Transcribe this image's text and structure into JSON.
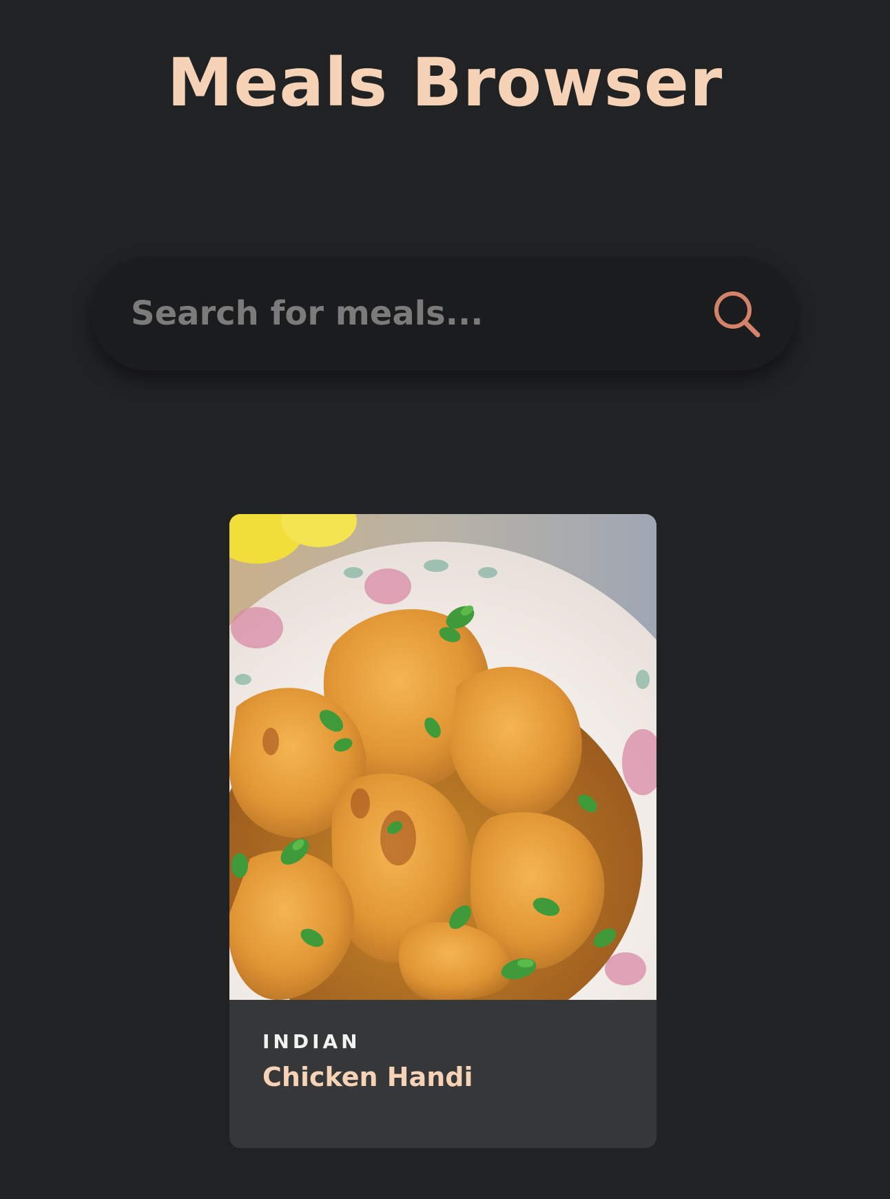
{
  "header": {
    "title": "Meals Browser"
  },
  "search": {
    "placeholder": "Search for meals...",
    "value": "",
    "icon": "search-icon"
  },
  "meals": [
    {
      "category": "INDIAN",
      "name": "Chicken Handi",
      "image": "chicken-curry-in-white-floral-bowl"
    }
  ],
  "colors": {
    "background": "#212224",
    "accent": "#f6d3b6",
    "search_icon": "#d4826a",
    "card_footer": "#363739"
  }
}
